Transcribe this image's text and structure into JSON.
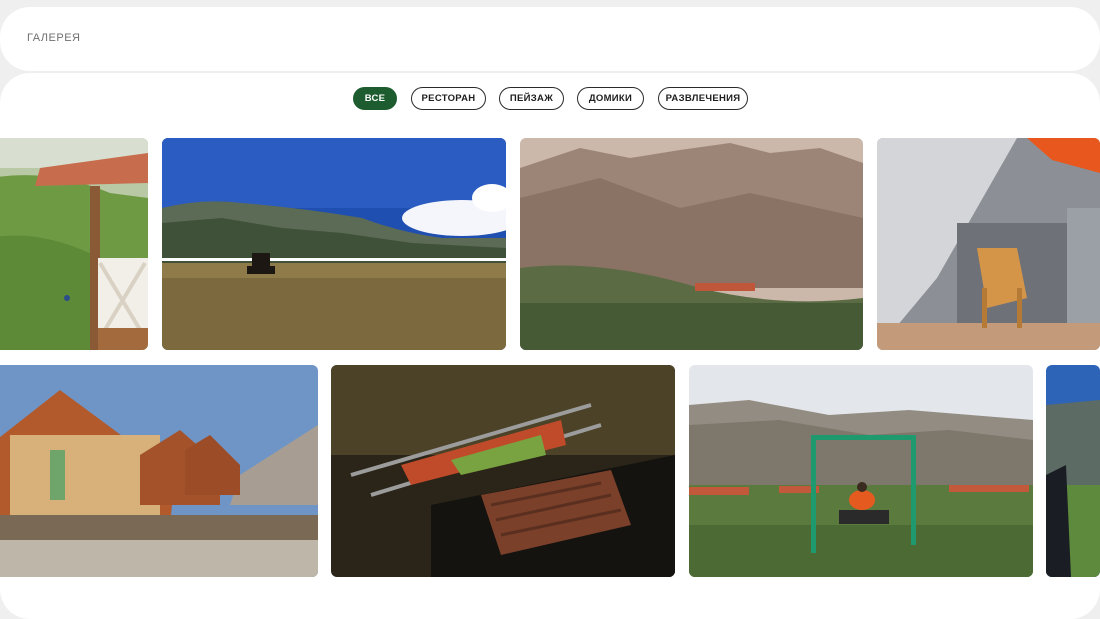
{
  "header": {
    "title": "ГАЛЕРЕЯ"
  },
  "filters": [
    {
      "label": "ВСЕ",
      "active": true
    },
    {
      "label": "РЕСТОРАН",
      "active": false
    },
    {
      "label": "ПЕЙЗАЖ",
      "active": false
    },
    {
      "label": "ДОМИКИ",
      "active": false
    },
    {
      "label": "РАЗВЛЕЧЕНИЯ",
      "active": false
    }
  ],
  "colors": {
    "accent": "#1d5c2e",
    "background": "#efefef",
    "card": "#ffffff"
  }
}
